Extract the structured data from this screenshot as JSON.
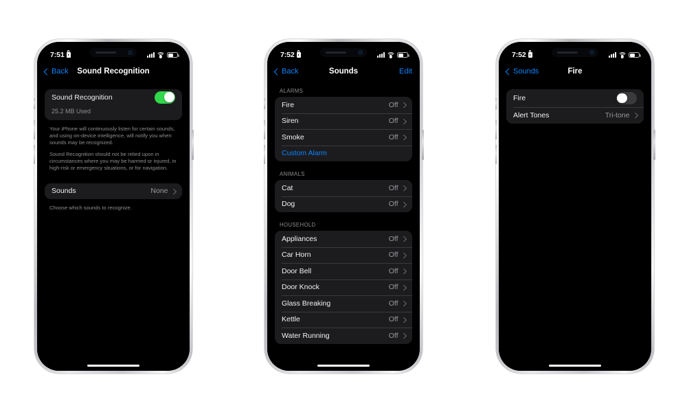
{
  "page": {
    "background_color": "#ffffff",
    "device_count": 3
  },
  "phones": [
    {
      "id": "phone-sound-recognition",
      "status_bar": {
        "time": "7:51",
        "lock_icon": "lock-icon",
        "signal_icon": "cellular-signal-icon",
        "wifi_icon": "wifi-icon",
        "battery_icon": "battery-icon"
      },
      "nav": {
        "back_label": "Back",
        "title": "Sound Recognition",
        "right_label": ""
      },
      "content": {
        "main_row": {
          "label": "Sound Recognition",
          "toggle_state": "on",
          "toggle_color": "#32d74b"
        },
        "storage_text": "25.2 MB Used",
        "footnotes": [
          "Your iPhone will continuously listen for certain sounds, and using on-device intelligence, will notify you when sounds may be recognized.",
          "Sound Recognition should not be relied upon in circumstances where you may be harmed or injured, in high-risk or emergency situations, or for navigation."
        ],
        "sounds_row": {
          "label": "Sounds",
          "value": "None"
        },
        "sounds_footnote": "Choose which sounds to recognize."
      }
    },
    {
      "id": "phone-sounds-list",
      "status_bar": {
        "time": "7:52",
        "lock_icon": "lock-icon",
        "signal_icon": "cellular-signal-icon",
        "wifi_icon": "wifi-icon",
        "battery_icon": "battery-icon"
      },
      "nav": {
        "back_label": "Back",
        "title": "Sounds",
        "right_label": "Edit"
      },
      "sections": [
        {
          "header": "ALARMS",
          "rows": [
            {
              "label": "Fire",
              "value": "Off",
              "style": "normal"
            },
            {
              "label": "Siren",
              "value": "Off",
              "style": "normal"
            },
            {
              "label": "Smoke",
              "value": "Off",
              "style": "normal"
            },
            {
              "label": "Custom Alarm",
              "value": "",
              "style": "blue"
            }
          ]
        },
        {
          "header": "ANIMALS",
          "rows": [
            {
              "label": "Cat",
              "value": "Off",
              "style": "normal"
            },
            {
              "label": "Dog",
              "value": "Off",
              "style": "normal"
            }
          ]
        },
        {
          "header": "HOUSEHOLD",
          "rows": [
            {
              "label": "Appliances",
              "value": "Off",
              "style": "normal"
            },
            {
              "label": "Car Horn",
              "value": "Off",
              "style": "normal"
            },
            {
              "label": "Door Bell",
              "value": "Off",
              "style": "normal"
            },
            {
              "label": "Door Knock",
              "value": "Off",
              "style": "normal"
            },
            {
              "label": "Glass Breaking",
              "value": "Off",
              "style": "normal"
            },
            {
              "label": "Kettle",
              "value": "Off",
              "style": "normal"
            },
            {
              "label": "Water Running",
              "value": "Off",
              "style": "normal"
            }
          ]
        }
      ]
    },
    {
      "id": "phone-fire-detail",
      "status_bar": {
        "time": "7:52",
        "lock_icon": "lock-icon",
        "signal_icon": "cellular-signal-icon",
        "wifi_icon": "wifi-icon",
        "battery_icon": "battery-icon"
      },
      "nav": {
        "back_label": "Sounds",
        "title": "Fire",
        "right_label": ""
      },
      "content": {
        "toggle_row": {
          "label": "Fire",
          "toggle_state": "off",
          "toggle_color": "#3a3a3c"
        },
        "alert_tones_row": {
          "label": "Alert Tones",
          "value": "Tri-tone"
        }
      }
    }
  ]
}
